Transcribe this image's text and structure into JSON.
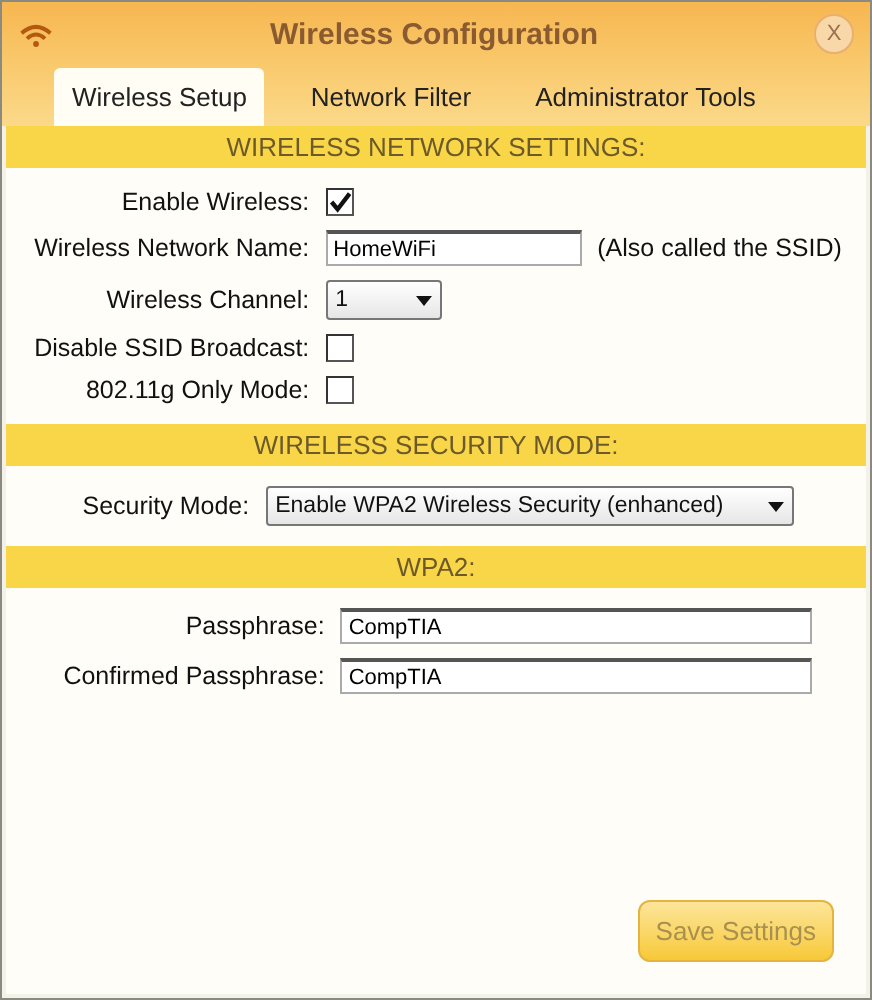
{
  "window": {
    "title": "Wireless Configuration",
    "close": "X"
  },
  "tabs": [
    {
      "label": "Wireless Setup",
      "selected": true
    },
    {
      "label": "Network Filter",
      "selected": false
    },
    {
      "label": "Administrator Tools",
      "selected": false
    }
  ],
  "sections": [
    {
      "heading": "WIRELESS NETWORK SETTINGS:",
      "fields": [
        {
          "kind": "checkbox",
          "label": "Enable Wireless:",
          "checked": true
        },
        {
          "kind": "text",
          "label": "Wireless Network Name:",
          "value": "HomeWiFi",
          "note": "(Also called the SSID)"
        },
        {
          "kind": "select",
          "label": "Wireless Channel:",
          "value": "1"
        },
        {
          "kind": "checkbox",
          "label": "Disable SSID Broadcast:",
          "checked": false
        },
        {
          "kind": "checkbox",
          "label": "802.11g Only Mode:",
          "checked": false
        }
      ]
    },
    {
      "heading": "WIRELESS SECURITY MODE:",
      "fields": [
        {
          "kind": "select",
          "label": "Security Mode:",
          "value": "Enable WPA2 Wireless Security (enhanced)"
        }
      ]
    },
    {
      "heading": "WPA2:",
      "fields": [
        {
          "kind": "text",
          "label": "Passphrase:",
          "value": "CompTIA"
        },
        {
          "kind": "text",
          "label": "Confirmed Passphrase:",
          "value": "CompTIA"
        }
      ]
    }
  ],
  "save_button": "Save Settings"
}
